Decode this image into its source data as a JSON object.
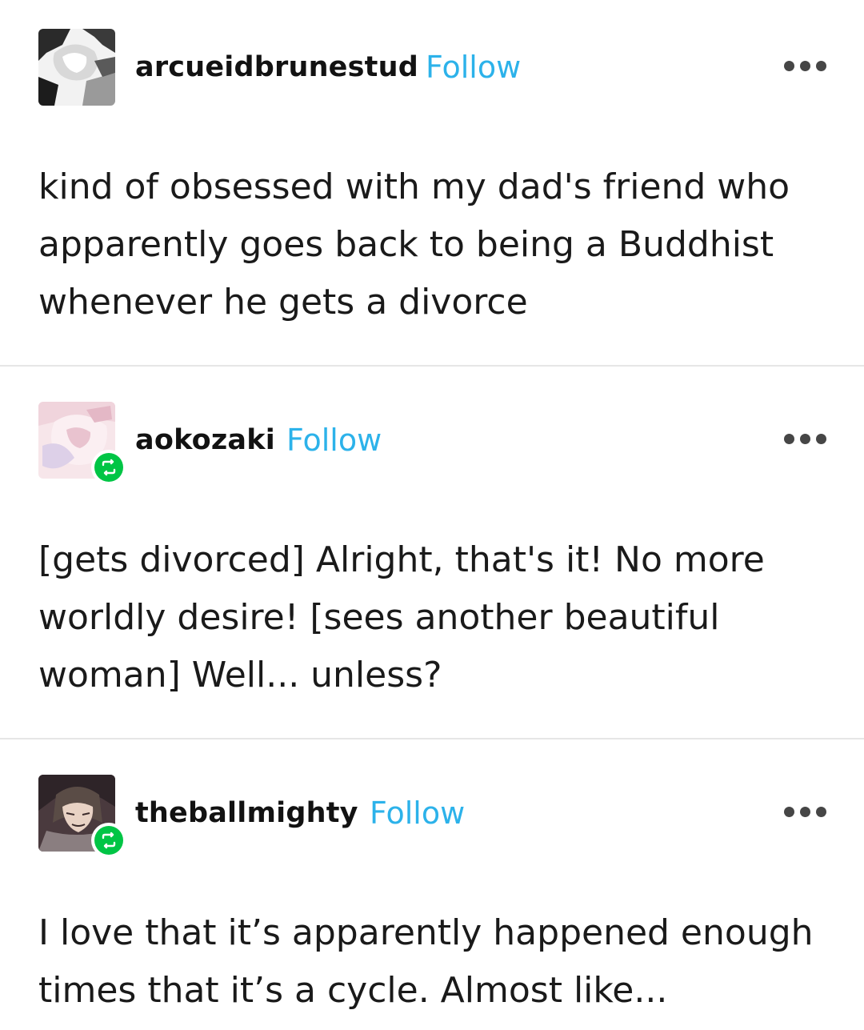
{
  "posts": [
    {
      "username": "arcueidbrunestud",
      "follow_label": "Follow",
      "avatar_icon": "user-avatar",
      "reblogged": false,
      "more_icon": "more-options-icon",
      "text": "kind of obsessed with my dad's friend who\napparently goes back to being a Buddhist\nwhenever he gets a divorce"
    },
    {
      "username": "aokozaki",
      "follow_label": "Follow",
      "avatar_icon": "user-avatar",
      "reblogged": true,
      "reblog_icon": "reblog-icon",
      "more_icon": "more-options-icon",
      "text": "[gets divorced] Alright, that's it! No more\nworldly desire! [sees another beautiful\nwoman] Well... unless?"
    },
    {
      "username": "theballmighty",
      "follow_label": "Follow",
      "avatar_icon": "user-avatar",
      "reblogged": true,
      "reblog_icon": "reblog-icon",
      "more_icon": "more-options-icon",
      "text": "I love that it’s apparently happened enough\ntimes that it’s a cycle. Almost like..."
    }
  ],
  "colors": {
    "follow": "#2cb2ea",
    "reblog_badge": "#00c545",
    "text": "#121212",
    "divider": "#e6e6e6"
  }
}
